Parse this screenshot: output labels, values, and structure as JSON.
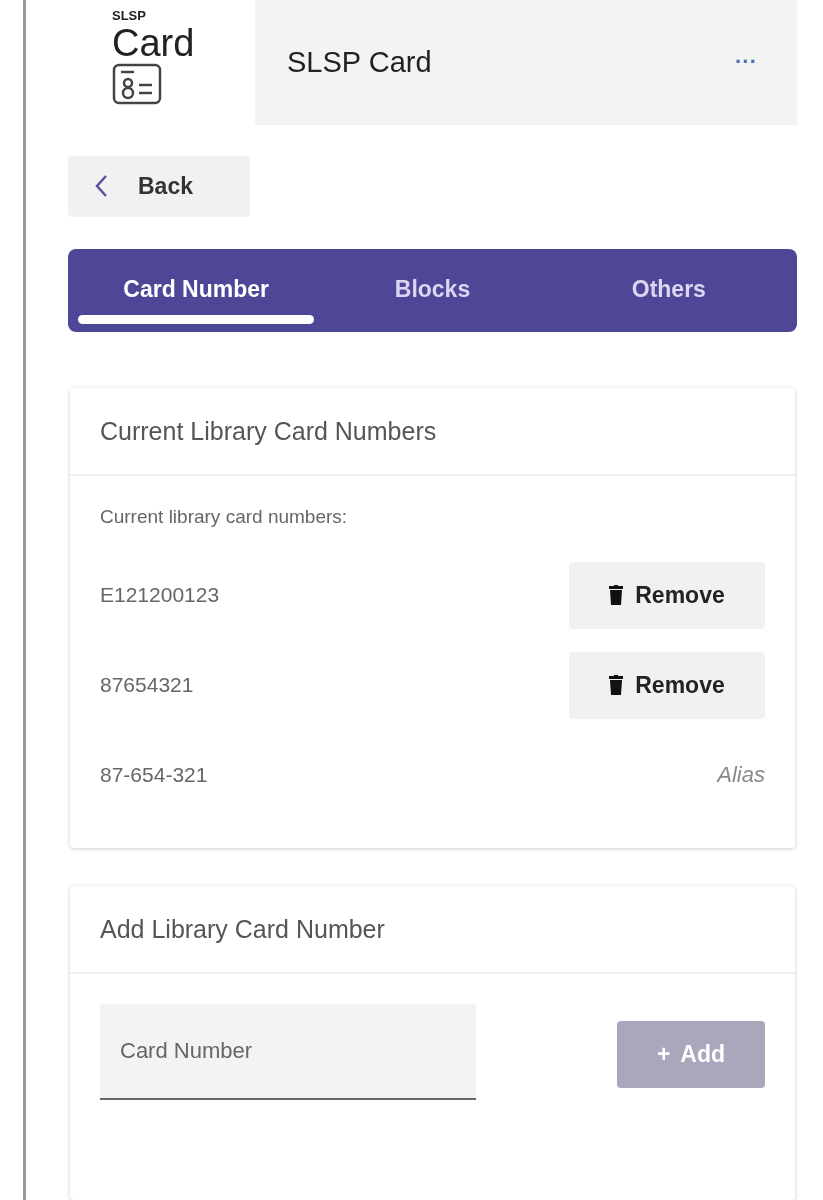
{
  "logo": {
    "small": "SLSP",
    "big": "Card"
  },
  "header": {
    "title": "SLSP Card",
    "menu": "···"
  },
  "back": {
    "label": "Back"
  },
  "tabs": [
    {
      "label": "Card Number",
      "selected": true
    },
    {
      "label": "Blocks",
      "selected": false
    },
    {
      "label": "Others",
      "selected": false
    }
  ],
  "current_card": {
    "title": "Current Library Card Numbers",
    "intro": "Current library card numbers:",
    "rows": [
      {
        "number": "E121200123",
        "kind": "removable",
        "action": "Remove"
      },
      {
        "number": "87654321",
        "kind": "removable",
        "action": "Remove"
      },
      {
        "number": "87-654-321",
        "kind": "alias",
        "note": "Alias"
      }
    ]
  },
  "add_card": {
    "title": "Add Library Card Number",
    "placeholder": "Card Number",
    "button": {
      "label": "Add",
      "icon": "+",
      "disabled": true
    }
  }
}
